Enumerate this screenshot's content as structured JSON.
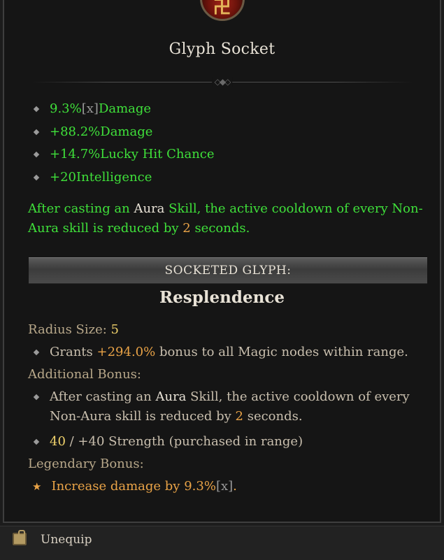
{
  "emblem": {
    "glyph": "卍",
    "icon": "glyph-emblem-icon"
  },
  "title": "Glyph Socket",
  "stats": [
    {
      "value": "9.3%",
      "bracket": "[x]",
      "label": " Damage"
    },
    {
      "value": "+88.2%",
      "bracket": "",
      "label": " Damage"
    },
    {
      "value": "+14.7%",
      "bracket": "",
      "label": " Lucky Hit Chance"
    },
    {
      "value": "+20",
      "bracket": "",
      "label": " Intelligence"
    }
  ],
  "aura_effect": {
    "p1": "After casting an ",
    "aura": "Aura",
    "p2": " Skill, the active cooldown of every Non-Aura skill is reduced by ",
    "num": "2",
    "p3": " seconds."
  },
  "socketed_header": "SOCKETED GLYPH:",
  "glyph_name": "Resplendence",
  "radius": {
    "label": "Radius Size: ",
    "value": "5"
  },
  "grants": {
    "p1": "Grants ",
    "value": "+294.0%",
    "p2": " bonus to all Magic nodes within range."
  },
  "additional_label": "Additional Bonus:",
  "additional": {
    "p1": "After casting an ",
    "aura": "Aura",
    "p2": " Skill, the active cooldown of every Non-Aura skill is reduced by ",
    "num": "2",
    "p3": " seconds."
  },
  "strength": {
    "current": "40",
    "p1": " / +40 Strength (purchased in range)"
  },
  "legendary_label": "Legendary Bonus:",
  "legendary": {
    "p1": "Increase damage by ",
    "value": "9.3%",
    "bracket": "[x]",
    "p2": "."
  },
  "footer": {
    "unequip_label": "Unequip",
    "icon": "unequip-icon"
  }
}
